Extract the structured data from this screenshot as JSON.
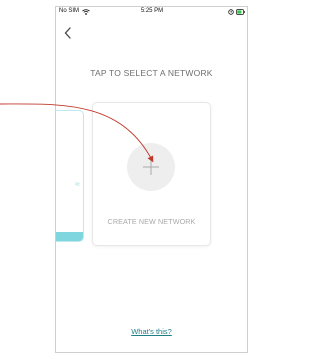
{
  "status_bar": {
    "carrier": "No SIM",
    "time": "5:25 PM"
  },
  "page": {
    "title": "TAP TO SELECT A NETWORK"
  },
  "network_card": {
    "label": "CREATE NEW NETWORK"
  },
  "footer": {
    "link_text": "What's this?"
  },
  "colors": {
    "accent": "#1f7d86",
    "peek_strip": "#7fd6de",
    "annotation_arrow": "#c0392b"
  },
  "icons": {
    "back": "chevron-left-icon",
    "add": "plus-icon",
    "wifi": "wifi-icon",
    "battery": "battery-icon"
  }
}
